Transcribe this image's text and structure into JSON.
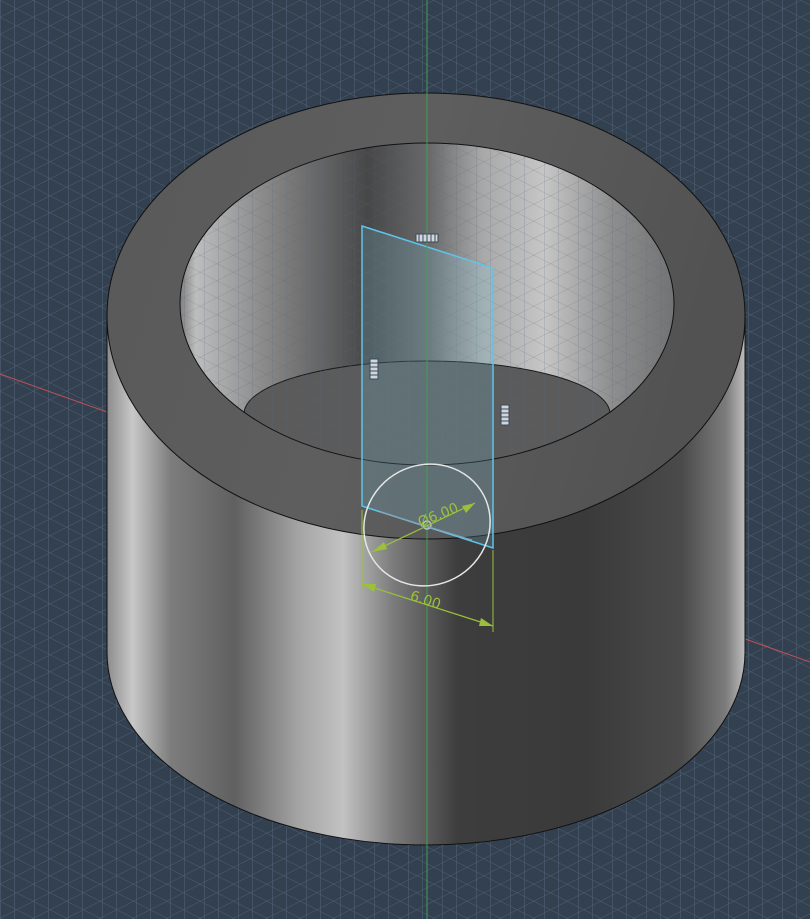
{
  "viewport": {
    "background": "#33404f",
    "grid_color": "#4f5f73",
    "axis_x_color": "#c0505a",
    "axis_z_color": "#3fa055"
  },
  "model": {
    "body_color_dark": "#3a3a3a",
    "body_color_light": "#9c9c9c",
    "edge_color": "#111111"
  },
  "sketch": {
    "plane_color": "#5fc4ea",
    "dimension_color": "#9bc03a",
    "circle_color": "#e6e6e6",
    "diameter_label": "Ø6.00",
    "width_label": "6.00"
  },
  "icons": {
    "top_handle": "plane-handle-icon",
    "left_handle": "plane-handle-icon",
    "right_handle": "plane-handle-icon"
  }
}
